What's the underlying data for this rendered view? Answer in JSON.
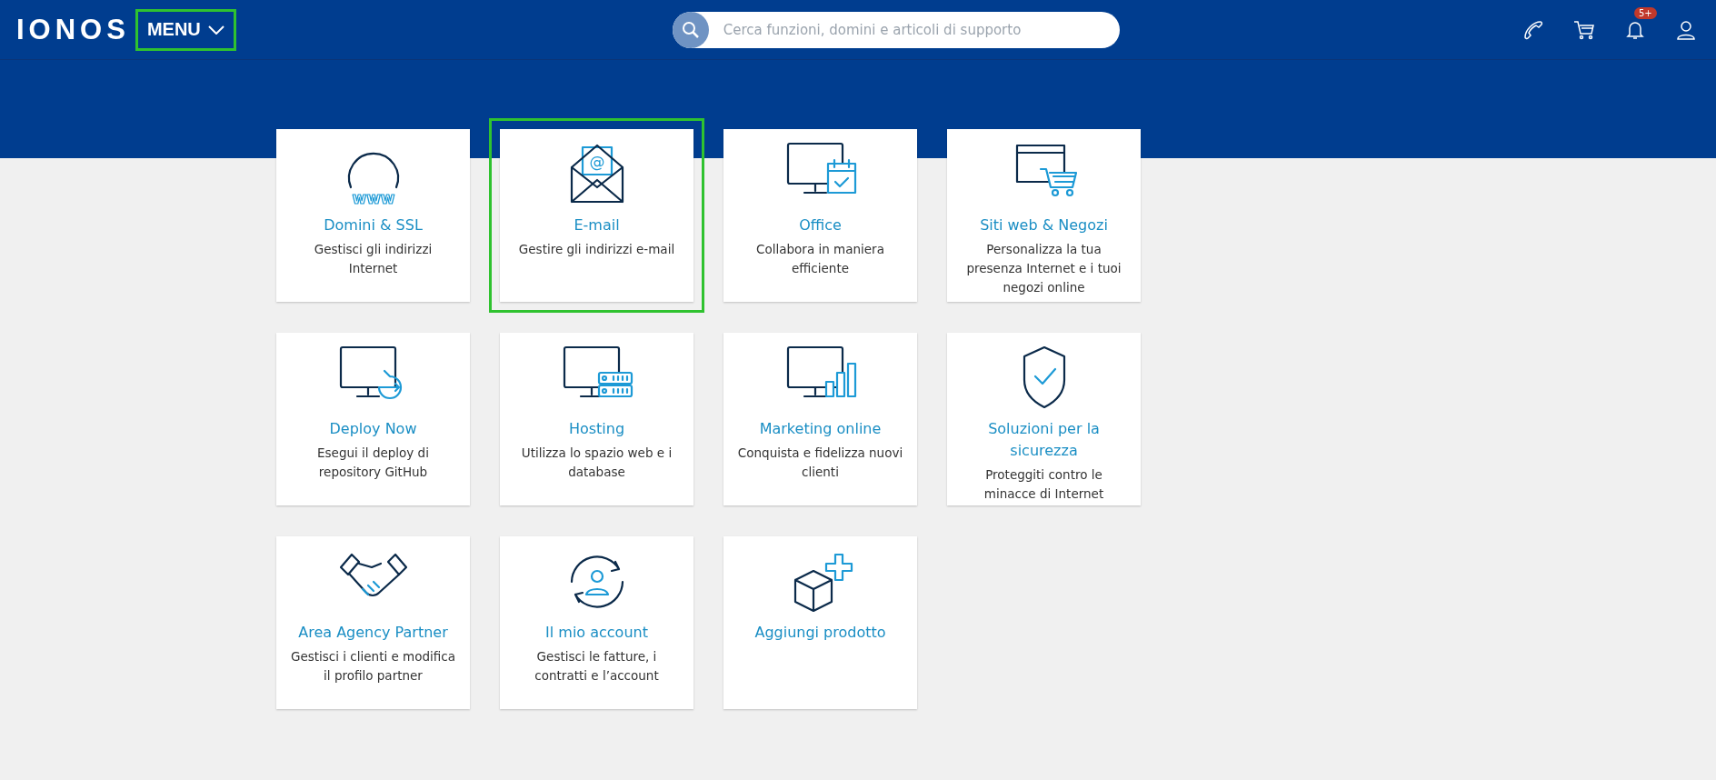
{
  "header": {
    "logo": "IONOS",
    "menu": {
      "label": "MENU",
      "highlighted": true
    },
    "search": {
      "placeholder": "Cerca funzioni, domini e articoli di supporto"
    },
    "notifications_badge": "5+"
  },
  "cards": [
    {
      "kind": "domains",
      "icon_text": "www",
      "title": "Domini & SSL",
      "description": "Gestisci gli indirizzi Internet",
      "highlighted": false
    },
    {
      "kind": "email",
      "icon_text": "@",
      "title": "E-mail",
      "description": "Gestire gli indirizzi e-mail",
      "highlighted": true
    },
    {
      "kind": "office",
      "title": "Office",
      "description": "Collabora in maniera efficiente",
      "highlighted": false
    },
    {
      "kind": "shop",
      "title": "Siti web & Negozi",
      "description": "Personalizza la tua presenza Internet e i tuoi negozi online",
      "highlighted": false
    },
    {
      "kind": "deploy",
      "title": "Deploy Now",
      "description": "Esegui il deploy di repository GitHub",
      "highlighted": false
    },
    {
      "kind": "hosting",
      "title": "Hosting",
      "description": "Utilizza lo spazio web e i database",
      "highlighted": false
    },
    {
      "kind": "marketing",
      "title": "Marketing online",
      "description": "Conquista e fidelizza nuovi clienti",
      "highlighted": false
    },
    {
      "kind": "security",
      "title": "Soluzioni per la sicurezza",
      "description": "Proteggiti contro le minacce di Internet",
      "highlighted": false
    },
    {
      "kind": "partner",
      "title": "Area Agency Partner",
      "description": "Gestisci i clienti e modifica il profilo partner",
      "highlighted": false
    },
    {
      "kind": "account",
      "title": "Il mio account",
      "description": "Gestisci le fatture, i contratti e l’account",
      "highlighted": false
    },
    {
      "kind": "add",
      "title": "Aggiungi prodotto",
      "highlighted": false
    }
  ]
}
